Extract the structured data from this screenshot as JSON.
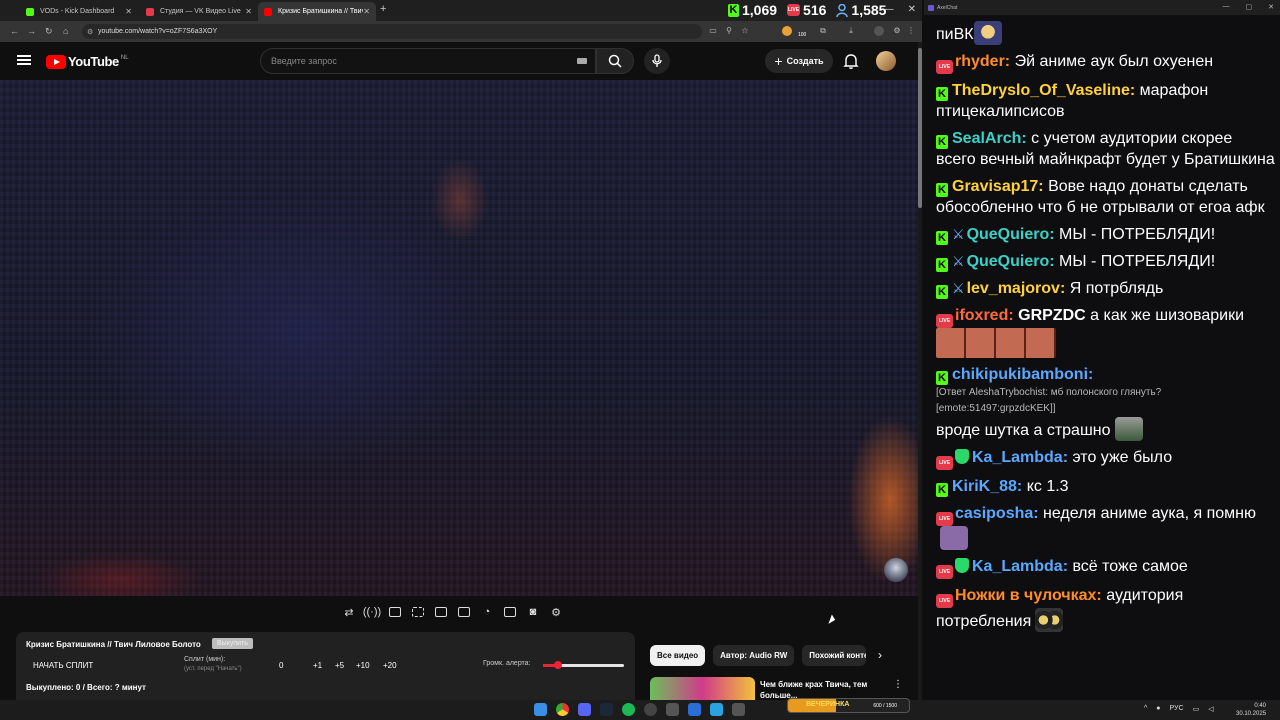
{
  "browser": {
    "tabs": [
      {
        "title": "VODs - Kick Dashboard",
        "color": "#53fc18"
      },
      {
        "title": "Студия — VK Видео Live",
        "color": "#e43b4a"
      },
      {
        "title": "Кризис Братишкина // Твич Л",
        "color": "#ff0000"
      }
    ],
    "url": "youtube.com/watch?v=oZF7S6a3XOY",
    "extension_badge": "100",
    "counters": [
      {
        "platform": "kick",
        "value": "1,069"
      },
      {
        "platform": "live",
        "value": "516"
      },
      {
        "platform": "viewers",
        "value": "1,585"
      }
    ]
  },
  "youtube": {
    "logo_text": "YouTube",
    "logo_region": "NL",
    "search_placeholder": "Введите запрос",
    "create_label": "Создать"
  },
  "split_panel": {
    "title": "Кризис Братишкина // Твич Лиловое Болото",
    "button": "Выкупить",
    "start_label": "НАЧАТЬ СПЛИТ",
    "split_min_label": "Сплит (мин):",
    "split_min_hint": "(уст. перед \"Начать\")",
    "split_value": "0",
    "increments": [
      "+1",
      "+5",
      "+10",
      "+20"
    ],
    "alert_volume_label": "Громк. алерта:",
    "alert_volume": 0.18,
    "bought_text": "Выкуплено: 0 / Всего: ? минут"
  },
  "chips": [
    "Все видео",
    "Автор: Audio RW",
    "Похожий контент"
  ],
  "related": {
    "title": "Чем ближе крах Твича, тем больше..."
  },
  "chat": {
    "window_title": "AxelChat",
    "messages": [
      {
        "badges": [],
        "user": "",
        "user_color": "#ffffff",
        "text": "пиВК",
        "emote": "#3a3f7a"
      },
      {
        "badges": [
          "live"
        ],
        "user": "rhyder:",
        "user_color": "#ff8c28",
        "text": "Эй аниме аук был охуенен"
      },
      {
        "badges": [
          "kick"
        ],
        "user": "TheDryslo_Of_Vaseline:",
        "user_color": "#ffd23a",
        "text": "марафон птицекалипсисов"
      },
      {
        "badges": [
          "kick"
        ],
        "user": "SealArch:",
        "user_color": "#3ad2c8",
        "text": "с учетом аудитории скорее всего вечный майнкрафт будет у Братишкина"
      },
      {
        "badges": [
          "kick"
        ],
        "user": "Gravisap17:",
        "user_color": "#ffd23a",
        "text": "Вове надо донаты сделать обособленно что б не отрывали от егоа афк"
      },
      {
        "badges": [
          "kick",
          "sword"
        ],
        "user": "QueQuiero:",
        "user_color": "#3ad2c8",
        "text": "МЫ - ПОТРЕБЛЯДИ!"
      },
      {
        "badges": [
          "kick",
          "sword"
        ],
        "user": "QueQuiero:",
        "user_color": "#3ad2c8",
        "text": "МЫ - ПОТРЕБЛЯДИ!"
      },
      {
        "badges": [
          "kick",
          "sword"
        ],
        "user": "lev_majorov:",
        "user_color": "#ffd23a",
        "text": "Я потрблядь"
      },
      {
        "badges": [
          "live"
        ],
        "user": "ifoxred:",
        "user_color": "#ff6a3a",
        "text_bold": "GRPZDC",
        "text": "а как же шизоварики"
      },
      {
        "badges": [
          "kick"
        ],
        "user": "chikipukibamboni:",
        "user_color": "#5aa8ff",
        "reply": "[Ответ AleshaTrybochist: мб полонского глянуть?",
        "reply2": "[emote:51497:grpzdcKEK]]",
        "text": "вроде шутка а страшно"
      },
      {
        "badges": [
          "live",
          "shield"
        ],
        "user": "Ka_Lambda:",
        "user_color": "#5aa8ff",
        "text": "это уже было"
      },
      {
        "badges": [
          "kick"
        ],
        "user": "KiriK_88:",
        "user_color": "#5aa8ff",
        "text": "кс 1.3"
      },
      {
        "badges": [
          "live"
        ],
        "user": "casiposha:",
        "user_color": "#5aa8ff",
        "text": "неделя аниме аука, я помню"
      },
      {
        "badges": [
          "live",
          "shield"
        ],
        "user": "Ka_Lambda:",
        "user_color": "#5aa8ff",
        "text": "всё тоже самое"
      },
      {
        "badges": [
          "live"
        ],
        "user": "Ножки в чулочках:",
        "user_color": "#ff8c28",
        "text": "аудитория потребления"
      }
    ]
  },
  "overlay": {
    "donation_label": "ВЕЧЕРИНКА",
    "donation_value": "600 / 1500",
    "donation_progress": 0.4
  },
  "taskbar": {
    "lang": "РУС",
    "time": "0:40",
    "date": "30.10.2025"
  }
}
